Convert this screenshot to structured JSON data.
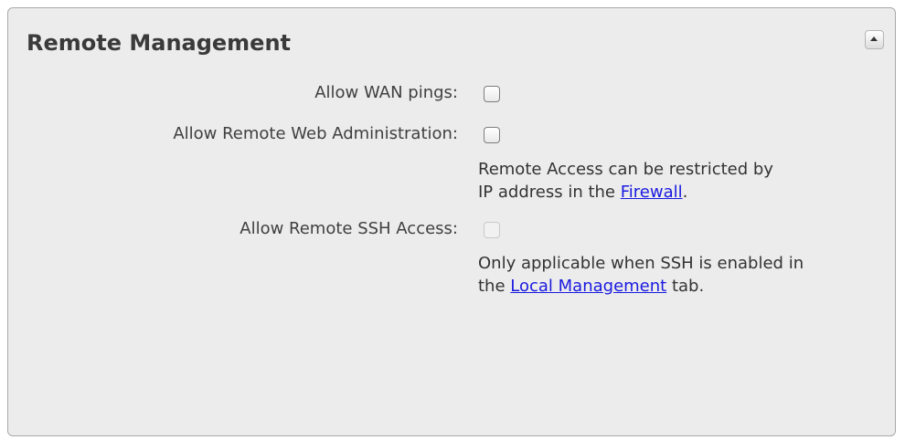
{
  "panel": {
    "title": "Remote Management",
    "collapse_icon": "collapse-up-icon"
  },
  "settings": {
    "wan_pings": {
      "label": "Allow WAN pings:",
      "checked": false,
      "disabled": false
    },
    "remote_web_admin": {
      "label": "Allow Remote Web Administration:",
      "checked": false,
      "disabled": false,
      "help_line1": "Remote Access can be restricted by",
      "help_line2_prefix": "IP address in the ",
      "help_link": "Firewall",
      "help_line2_suffix": "."
    },
    "remote_ssh": {
      "label": "Allow Remote SSH Access:",
      "checked": false,
      "disabled": true,
      "help_line1": "Only applicable when SSH is enabled in",
      "help_line2_prefix": "the ",
      "help_link": "Local Management",
      "help_line2_suffix": " tab."
    }
  },
  "colors": {
    "panel_bg": "#ececec",
    "link": "#1a1ae0"
  }
}
